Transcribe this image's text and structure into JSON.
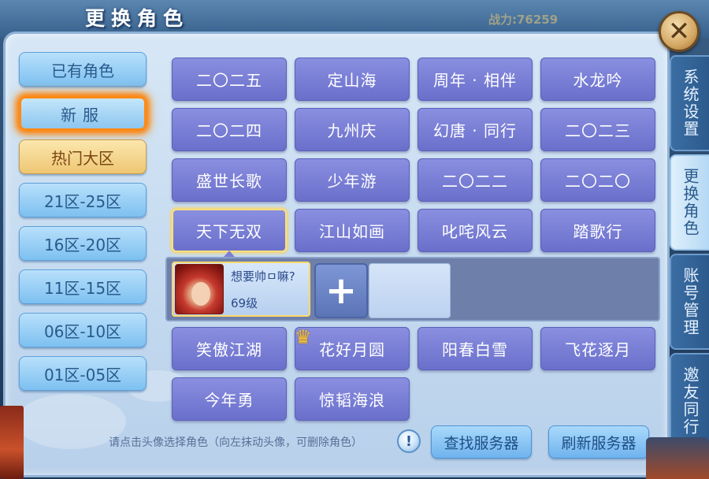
{
  "title": "更换角色",
  "background_stats": "战力:76259",
  "close_button": "✕",
  "left_menu": [
    {
      "label": "已有角色",
      "state": "normal"
    },
    {
      "label": "新服",
      "state": "selected"
    },
    {
      "label": "热门大区",
      "state": "hot"
    },
    {
      "label": "21区-25区",
      "state": "normal"
    },
    {
      "label": "16区-20区",
      "state": "normal"
    },
    {
      "label": "11区-15区",
      "state": "normal"
    },
    {
      "label": "06区-10区",
      "state": "normal"
    },
    {
      "label": "01区-05区",
      "state": "normal"
    }
  ],
  "servers": [
    [
      "二〇二五",
      "定山海",
      "周年 · 相伴",
      "水龙吟"
    ],
    [
      "二〇二四",
      "九州庆",
      "幻唐 · 同行",
      "二〇二三"
    ],
    [
      "盛世长歌",
      "少年游",
      "二〇二二",
      "二〇二〇"
    ],
    [
      "天下无双",
      "江山如画",
      "叱咤风云",
      "踏歌行"
    ],
    [
      "笑傲江湖",
      "花好月圆",
      "阳春白雪",
      "飞花逐月"
    ],
    [
      "今年勇",
      "惊韬海浪"
    ]
  ],
  "active_server": "天下无双",
  "role": {
    "name": "想要帅ㅁ嘛?",
    "level": "69级"
  },
  "add_role": "+",
  "hint": "请点击头像选择角色（向左抹动头像，可删除角色）",
  "hint_icon": "!",
  "buttons": {
    "find": "查找服务器",
    "refresh": "刷新服务器"
  },
  "right_tabs": [
    {
      "label": "系统设置",
      "active": false
    },
    {
      "label": "更换角色",
      "active": true
    },
    {
      "label": "账号管理",
      "active": false
    },
    {
      "label": "邀友同行",
      "active": false
    }
  ],
  "colors": {
    "server_button": "#7a7fd8",
    "selected_glow": "#ff7a00",
    "hot_tab": "#eec673",
    "panel": "#c3d9ef"
  }
}
